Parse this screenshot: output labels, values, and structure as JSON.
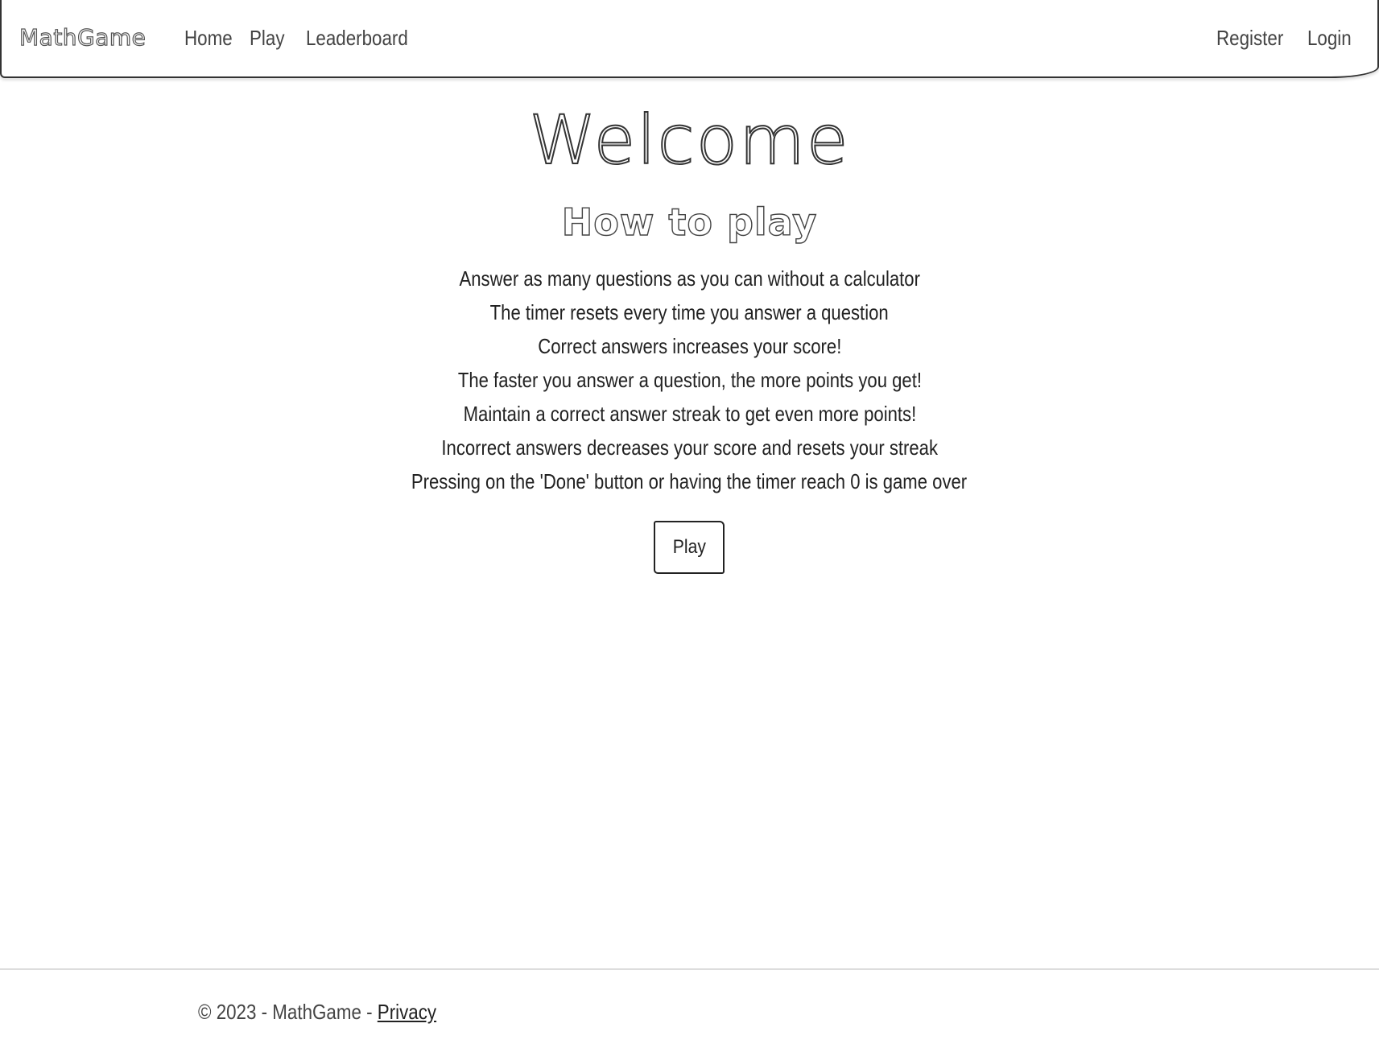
{
  "navbar": {
    "brand": "MathGame",
    "left_links": [
      {
        "label": "Home"
      },
      {
        "label": "Play"
      },
      {
        "label": "Leaderboard"
      }
    ],
    "right_links": [
      {
        "label": "Register"
      },
      {
        "label": "Login"
      }
    ]
  },
  "main": {
    "title": "Welcome",
    "subtitle": "How to play",
    "rules": [
      "Answer as many questions as you can without a calculator",
      "The timer resets every time you answer a question",
      "Correct answers increases your score!",
      "The faster you answer a question, the more points you get!",
      "Maintain a correct answer streak to get even more points!",
      "Incorrect answers decreases your score and resets your streak",
      "Pressing on the 'Done' button or having the timer reach 0 is game over"
    ],
    "play_button": "Play"
  },
  "footer": {
    "copyright": "© 2023 - MathGame - ",
    "privacy_link": "Privacy"
  }
}
